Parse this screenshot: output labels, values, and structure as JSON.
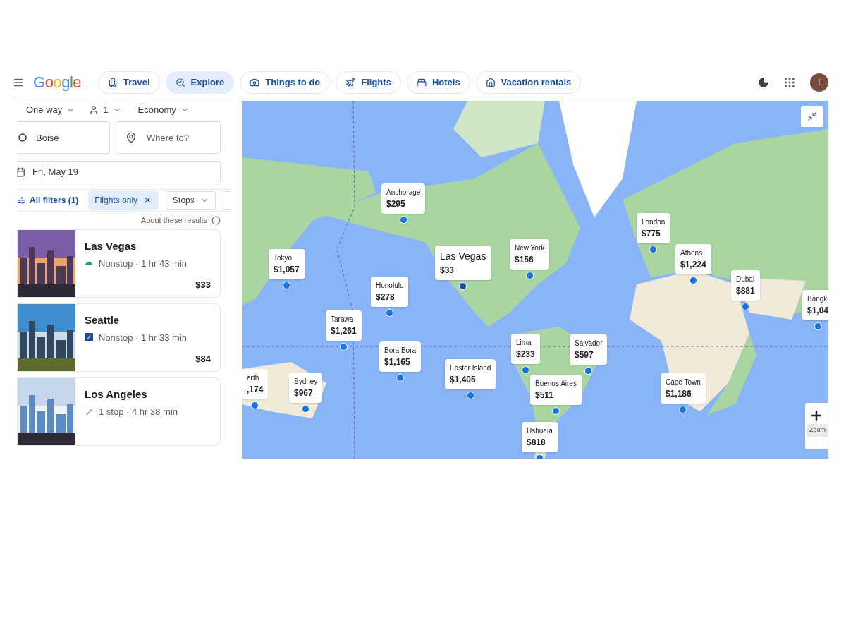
{
  "header": {
    "logo": "Google",
    "avatar": "t",
    "tabs": [
      {
        "label": "Travel",
        "kind": "luggage",
        "selected": false
      },
      {
        "label": "Explore",
        "kind": "explore",
        "selected": true
      },
      {
        "label": "Things to do",
        "kind": "camera",
        "selected": false
      },
      {
        "label": "Flights",
        "kind": "plane",
        "selected": false
      },
      {
        "label": "Hotels",
        "kind": "bed",
        "selected": false
      },
      {
        "label": "Vacation rentals",
        "kind": "house",
        "selected": false
      }
    ]
  },
  "search": {
    "trip_type": "One way",
    "passengers": "1",
    "cabin": "Economy",
    "origin": "Boise",
    "destination": {
      "placeholder": "Where to?"
    },
    "date": "Fri, May 19"
  },
  "filters": [
    {
      "kind": "all",
      "label": "All filters (1)"
    },
    {
      "kind": "chip",
      "label": "Flights only",
      "selected": true
    },
    {
      "kind": "dropdown",
      "label": "Stops"
    }
  ],
  "results_note": "About these results",
  "results": [
    {
      "city": "Las Vegas",
      "kind": "arc",
      "details": "Nonstop · 1 hr 43 min",
      "price": "$33"
    },
    {
      "city": "Seattle",
      "kind": "square",
      "details": "Nonstop · 1 hr 33 min",
      "price": "$84"
    },
    {
      "city": "Los Angeles",
      "kind": "slash",
      "details": "1 stop · 4 hr 38 min"
    }
  ],
  "map": {
    "zoom_tooltip": "Zoom",
    "callouts": [
      {
        "city": "Anchorage",
        "price": "$295",
        "selected": false
      },
      {
        "city": "Tokyo",
        "price": "$1,057",
        "selected": false
      },
      {
        "city": "Las Vegas",
        "price": "$33",
        "selected": true
      },
      {
        "city": "New York",
        "price": "$156",
        "selected": false
      },
      {
        "city": "Honolulu",
        "price": "$278",
        "selected": false
      },
      {
        "city": "Tarawa",
        "price": "$1,261",
        "selected": false
      },
      {
        "city": "Bora Bora",
        "price": "$1,165",
        "selected": false
      },
      {
        "city": "Easter Island",
        "price": "$1,405",
        "selected": false
      },
      {
        "city": "Lima",
        "price": "$233",
        "selected": false
      },
      {
        "city": "Salvador",
        "price": "$597",
        "selected": false
      },
      {
        "city": "Buenos Aires",
        "price": "$511",
        "selected": false
      },
      {
        "city": "Ushuaia",
        "price": "$818",
        "selected": false
      },
      {
        "city": "London",
        "price": "$775",
        "selected": false
      },
      {
        "city": "Athens",
        "price": "$1,224",
        "selected": false
      },
      {
        "city": "Dubai",
        "price": "$881",
        "selected": false
      },
      {
        "city": "Bangk",
        "price": "$1,04",
        "selected": false
      },
      {
        "city": "Cape Town",
        "price": "$1,186",
        "selected": false
      },
      {
        "city": "erth",
        "price": ",174",
        "selected": false
      },
      {
        "city": "Sydney",
        "price": "$967",
        "selected": false
      }
    ]
  }
}
